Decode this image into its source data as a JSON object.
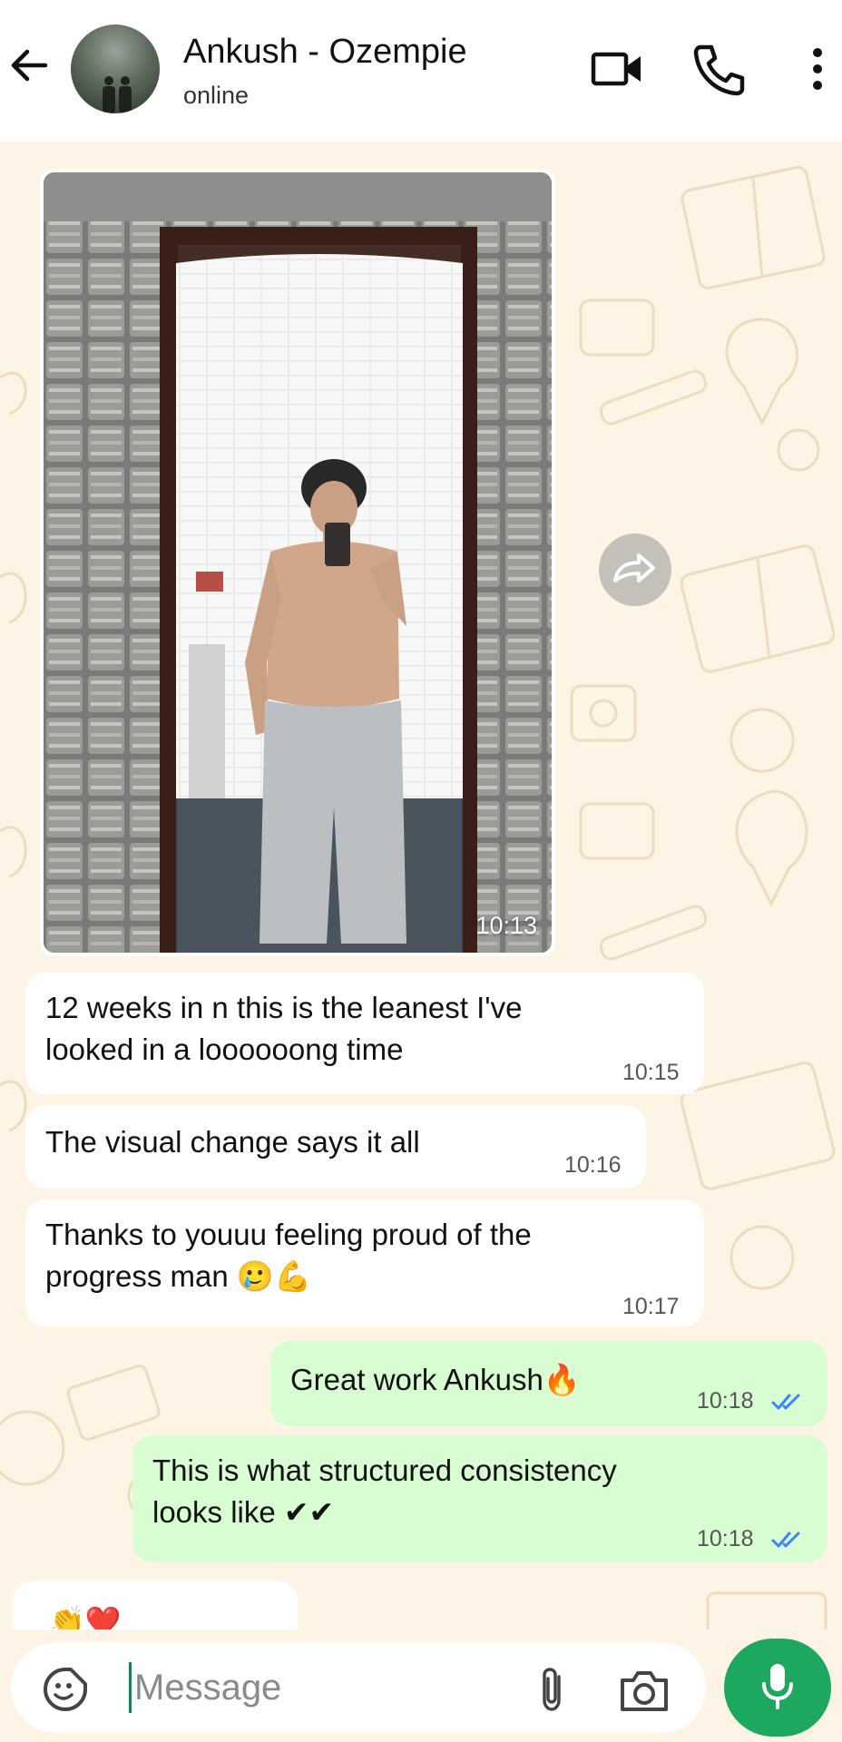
{
  "header": {
    "contact_name": "Ankush - Ozempie",
    "status": "online",
    "icons": [
      "back-arrow-icon",
      "avatar",
      "video-call-icon",
      "voice-call-icon",
      "more-options-icon"
    ]
  },
  "messages": [
    {
      "direction": "in",
      "type": "image",
      "time": "10:13"
    },
    {
      "direction": "in",
      "type": "text",
      "lines": [
        "12 weeks in n this is the leanest I've",
        "looked in a loooooong time"
      ],
      "time": "10:15"
    },
    {
      "direction": "in",
      "type": "text",
      "lines": [
        "The visual change says it all"
      ],
      "time": "10:16"
    },
    {
      "direction": "in",
      "type": "text",
      "lines": [
        "Thanks to youuu feeling proud of the",
        "progress man 🥲💪"
      ],
      "time": "10:17"
    },
    {
      "direction": "out",
      "type": "text",
      "lines": [
        "Great work Ankush🔥"
      ],
      "time": "10:18",
      "status": "read"
    },
    {
      "direction": "out",
      "type": "text",
      "lines": [
        "This is what structured consistency",
        "looks like ✔✔"
      ],
      "time": "10:18",
      "status": "read"
    },
    {
      "direction": "in",
      "type": "reaction-partial",
      "lines": [
        "👏❤️"
      ]
    }
  ],
  "input": {
    "placeholder": "Message"
  },
  "colors": {
    "chat_bg": "#fdf4e6",
    "incoming_bubble": "#ffffff",
    "outgoing_bubble": "#d9fdd3",
    "accent_green": "#1da760",
    "read_ticks": "#3b82f6"
  }
}
